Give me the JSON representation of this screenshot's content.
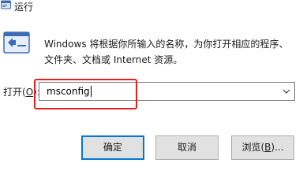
{
  "window": {
    "title": "运行",
    "icon": "run-app-icon"
  },
  "description": {
    "line1": "Windows 将根据你所输入的名称，为你打开相应的程序、",
    "line2": "文件夹、文档或 Internet 资源。"
  },
  "open_field": {
    "label_prefix": "打开(",
    "label_key": "O",
    "label_suffix": "):",
    "value": "msconfig"
  },
  "buttons": {
    "ok": "确定",
    "cancel": "取消",
    "browse_prefix": "浏览(",
    "browse_key": "B",
    "browse_suffix": ")..."
  },
  "colors": {
    "highlight": "#e81f1f",
    "primary_border": "#0078d7"
  }
}
